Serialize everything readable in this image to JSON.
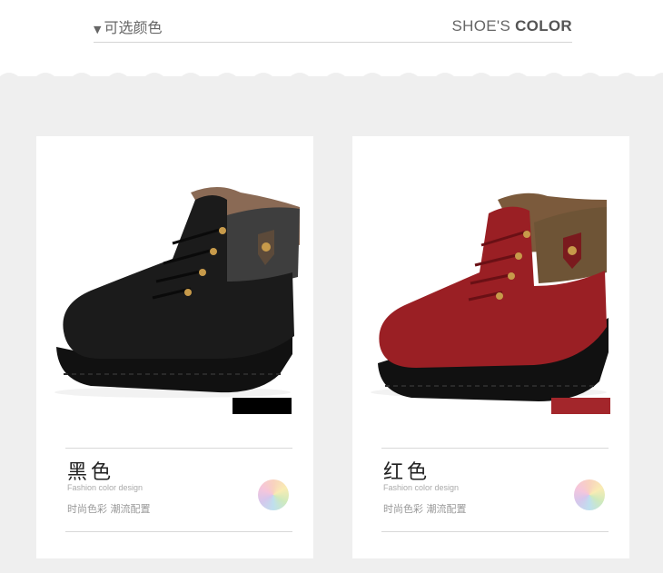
{
  "header": {
    "left_title": "可选颜色",
    "right_title_prefix": "SHOE'S",
    "right_title_bold": "COLOR"
  },
  "cards": [
    {
      "color_name": "黑色",
      "english": "Fashion color design",
      "chinese_tagline": "时尚色彩 潮流配置",
      "swatch_color": "#000000",
      "boot_color": "#1b1b1b"
    },
    {
      "color_name": "红色",
      "english": "Fashion color design",
      "chinese_tagline": "时尚色彩 潮流配置",
      "swatch_color": "#a3262b",
      "boot_color": "#9a1f24"
    }
  ]
}
